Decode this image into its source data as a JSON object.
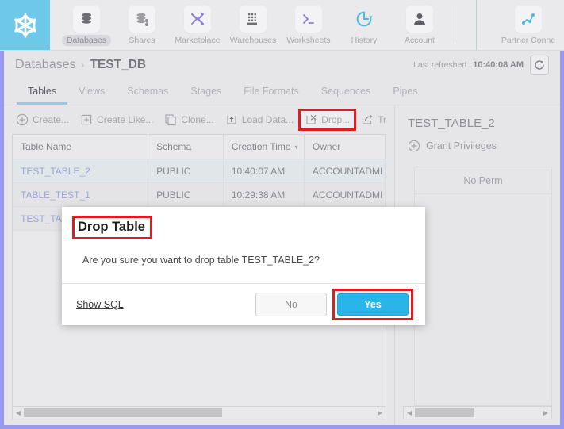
{
  "topnav": {
    "logo": "snowflake-logo",
    "items": [
      {
        "label": "Databases",
        "icon": "databases-icon",
        "active": true
      },
      {
        "label": "Shares",
        "icon": "shares-icon",
        "active": false
      },
      {
        "label": "Marketplace",
        "icon": "marketplace-icon",
        "active": false
      },
      {
        "label": "Warehouses",
        "icon": "warehouses-icon",
        "active": false
      },
      {
        "label": "Worksheets",
        "icon": "worksheets-icon",
        "active": false
      },
      {
        "label": "History",
        "icon": "history-icon",
        "active": false
      },
      {
        "label": "Account",
        "icon": "account-icon",
        "active": false
      }
    ],
    "right_item": {
      "label": "Partner Conne",
      "icon": "partner-connect-icon"
    }
  },
  "breadcrumb": {
    "root": "Databases",
    "separator": "›",
    "current": "TEST_DB"
  },
  "refresh": {
    "label": "Last refreshed",
    "time": "10:40:08 AM",
    "icon": "refresh-icon"
  },
  "tabs": [
    {
      "label": "Tables",
      "active": true
    },
    {
      "label": "Views",
      "active": false
    },
    {
      "label": "Schemas",
      "active": false
    },
    {
      "label": "Stages",
      "active": false
    },
    {
      "label": "File Formats",
      "active": false
    },
    {
      "label": "Sequences",
      "active": false
    },
    {
      "label": "Pipes",
      "active": false
    }
  ],
  "actionbar": [
    {
      "label": "Create...",
      "icon": "plus-circle-icon",
      "highlighted": false
    },
    {
      "label": "Create Like...",
      "icon": "copy-plus-icon",
      "highlighted": false
    },
    {
      "label": "Clone...",
      "icon": "clone-icon",
      "highlighted": false
    },
    {
      "label": "Load Data...",
      "icon": "load-data-icon",
      "highlighted": false
    },
    {
      "label": "Drop...",
      "icon": "drop-icon",
      "highlighted": true
    },
    {
      "label": "Tr",
      "icon": "transfer-icon",
      "highlighted": false
    }
  ],
  "table": {
    "columns": [
      "Table Name",
      "Schema",
      "Creation Time",
      "Owner"
    ],
    "sorted_column": "Creation Time",
    "sort_caret": "▾",
    "rows": [
      {
        "name": "TEST_TABLE_2",
        "schema": "PUBLIC",
        "created": "10:40:07 AM",
        "owner": "ACCOUNTADMI",
        "selected": true
      },
      {
        "name": "TABLE_TEST_1",
        "schema": "PUBLIC",
        "created": "10:29:38 AM",
        "owner": "ACCOUNTADMI",
        "selected": false
      },
      {
        "name": "TEST_TABLE",
        "schema": "",
        "created": "",
        "owner": "",
        "selected": false
      }
    ]
  },
  "scrollbars": {
    "left_arrow": "◀",
    "right_arrow": "▶"
  },
  "right_panel": {
    "title": "TEST_TABLE_2",
    "grant_label": "Grant Privileges",
    "grant_icon": "plus-circle-icon",
    "empty_text": "No Perm"
  },
  "modal": {
    "title": "Drop Table",
    "message": "Are you sure you want to drop table TEST_TABLE_2?",
    "show_sql": "Show SQL",
    "no_label": "No",
    "yes_label": "Yes"
  },
  "colors": {
    "accent_blue": "#29b5e8",
    "logo_bg": "#6ec8e8",
    "highlight_red": "#e01b22",
    "frame_purple": "#9a9aec",
    "tab_underline": "#8fd0e8"
  }
}
